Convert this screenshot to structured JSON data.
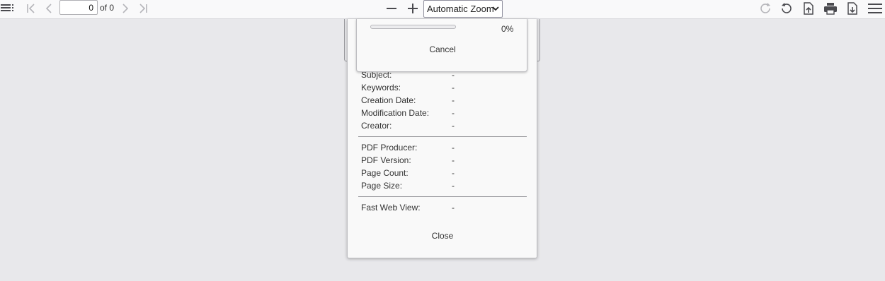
{
  "toolbar": {
    "page_number": "0",
    "page_count_text": "of 0",
    "zoom_value": "Automatic Zoom",
    "zoom_options": [
      "Automatic Zoom"
    ],
    "icons": {
      "sidebar": "sidebar-toggle-icon",
      "first": "first-page-icon",
      "prev": "previous-page-icon",
      "next": "next-page-icon",
      "last": "last-page-icon",
      "zoom_out": "zoom-out-icon",
      "zoom_in": "zoom-in-icon",
      "rotate_cw": "rotate-clockwise-icon",
      "rotate_ccw": "rotate-counterclockwise-icon",
      "open": "open-file-icon",
      "print": "print-icon",
      "download": "download-icon",
      "tools": "tools-menu-icon"
    }
  },
  "progress": {
    "percent_value": 0,
    "percent_text": "0%",
    "cancel_label": "Cancel"
  },
  "properties": {
    "group1": [
      {
        "label": "Subject:",
        "value": "-"
      },
      {
        "label": "Keywords:",
        "value": "-"
      },
      {
        "label": "Creation Date:",
        "value": "-"
      },
      {
        "label": "Modification Date:",
        "value": "-"
      },
      {
        "label": "Creator:",
        "value": "-"
      }
    ],
    "group2": [
      {
        "label": "PDF Producer:",
        "value": "-"
      },
      {
        "label": "PDF Version:",
        "value": "-"
      },
      {
        "label": "Page Count:",
        "value": "-"
      },
      {
        "label": "Page Size:",
        "value": "-"
      }
    ],
    "group3": [
      {
        "label": "Fast Web View:",
        "value": "-"
      }
    ],
    "close_label": "Close"
  },
  "colors": {
    "background": "#e8e8eb",
    "toolbar": "#f9f9fa",
    "dialog": "#f9f9f9",
    "accent": "#0a84ff"
  }
}
